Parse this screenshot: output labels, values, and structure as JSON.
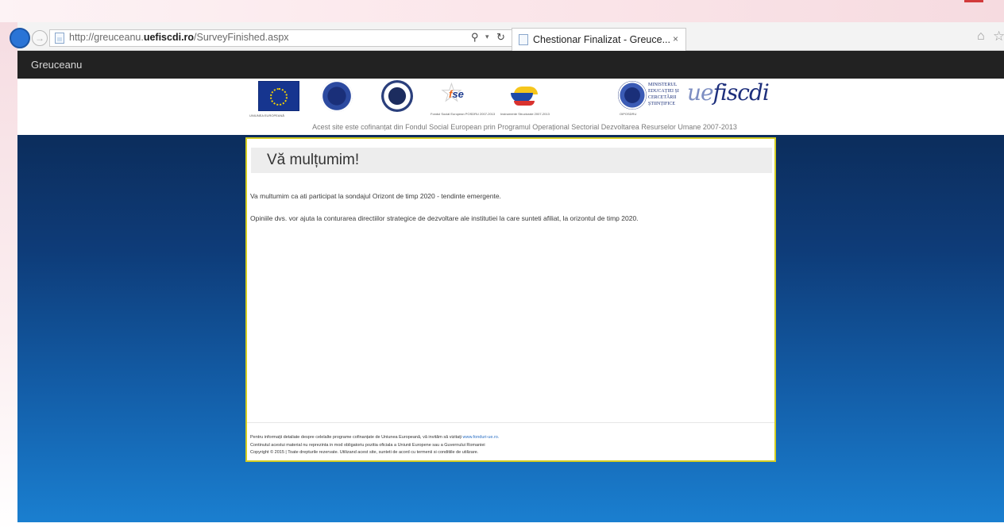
{
  "browser": {
    "url_prefix": "http://greuceanu.",
    "url_domain": "uefiscdi.ro",
    "url_path": "/SurveyFinished.aspx",
    "tab_title": "Chestionar Finalizat - Greuce...",
    "tab_close": "×"
  },
  "nav": {
    "brand": "Greuceanu"
  },
  "logos": {
    "eu_caption": "UNIUNEA EUROPEANĂ",
    "fse_text_1": "f",
    "fse_text_2": "se",
    "fse_caption": "Fondul Social European POSDRU 2007-2013",
    "is_caption": "Instrumente Structurale 2007-2013",
    "ministry_text": "MINISTERUL\nEDUCAȚIEI ȘI\nCERCETĂRII\nȘTIINȚIFICE",
    "ministry_caption": "OIPOSDRU",
    "uefiscdi_1": "ue",
    "uefiscdi_2": "fiscdi",
    "cofinance_text": "Acest site este cofinanțat din Fondul Social European prin Programul Operațional Sectorial Dezvoltarea Resurselor Umane 2007-2013"
  },
  "panel": {
    "title": "Vă mulțumim!",
    "message_1": "Va multumim ca ati participat la sondajul Orizont de timp 2020 - tendinte emergente.",
    "message_2": "Opiniile dvs. vor ajuta la conturarea directiilor strategice de dezvoltare ale institutiei la care sunteti afiliat, la orizontul de timp 2020.",
    "footer_1_text": "Pentru informații detaliate despre celelalte programe cofinanțate de Uniunea Europeană, vă invităm să vizitați ",
    "footer_1_link": "www.fonduri-ue.ro.",
    "footer_2": "Continutul acestui material nu reprezinta in mod obligatoriu pozitia oficiala a Uniunii Europene sau a Guvernului Romaniei",
    "footer_3": "Copyright © 2015 | Toate drepturile rezervate. Utilizand acest site, sunteti de acord cu termenii si conditiile de utilizare."
  },
  "colors": {
    "navbar": "#222222",
    "panel_border": "#d4cd22",
    "background_top": "#0c2d5c",
    "background_bottom": "#1a7fd0"
  }
}
